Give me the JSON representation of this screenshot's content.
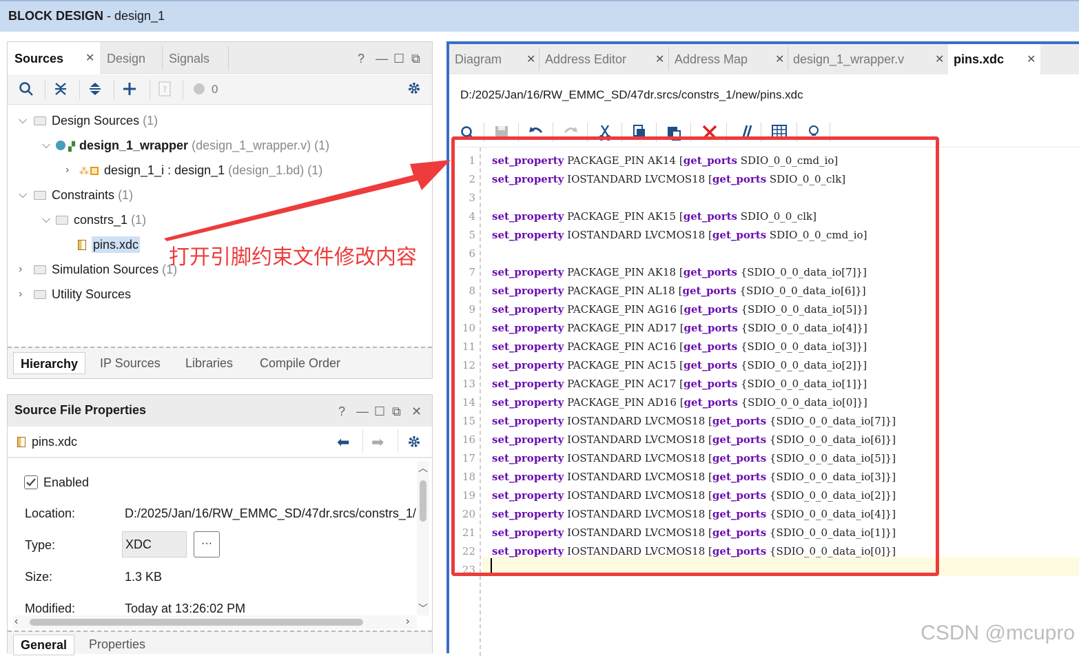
{
  "window": {
    "title_bold": "BLOCK DESIGN",
    "title_rest": " - design_1"
  },
  "sources_panel": {
    "tabs": [
      "Sources",
      "Design",
      "Signals"
    ],
    "help": "?",
    "count": "0",
    "tree": {
      "design_sources": {
        "label": "Design Sources",
        "count": "(1)"
      },
      "wrapper": {
        "label": "design_1_wrapper",
        "detail": "(design_1_wrapper.v) (1)"
      },
      "design_1_i": {
        "label": "design_1_i : design_1",
        "detail": "(design_1.bd) (1)"
      },
      "constraints": {
        "label": "Constraints",
        "count": "(1)"
      },
      "constrs_1": {
        "label": "constrs_1",
        "count": "(1)"
      },
      "pins": {
        "label": "pins.xdc"
      },
      "simulation": {
        "label": "Simulation Sources",
        "count": "(1)"
      },
      "utility": {
        "label": "Utility Sources"
      }
    },
    "bottom_tabs": [
      "Hierarchy",
      "IP Sources",
      "Libraries",
      "Compile Order"
    ]
  },
  "properties_panel": {
    "title": "Source File Properties",
    "help": "?",
    "file": "pins.xdc",
    "enabled_label": "Enabled",
    "enabled": true,
    "location_label": "Location:",
    "location": "D:/2025/Jan/16/RW_EMMC_SD/47dr.srcs/constrs_1/",
    "type_label": "Type:",
    "type": "XDC",
    "browse": "···",
    "size_label": "Size:",
    "size": "1.3 KB",
    "modified_label": "Modified:",
    "modified": "Today at 13:26:02 PM",
    "bottom_tabs": [
      "General",
      "Properties"
    ]
  },
  "editor": {
    "tabs": [
      "Diagram",
      "Address Editor",
      "Address Map",
      "design_1_wrapper.v",
      "pins.xdc"
    ],
    "path": "D:/2025/Jan/16/RW_EMMC_SD/47dr.srcs/constrs_1/new/pins.xdc",
    "lines": [
      {
        "n": "1",
        "a": "set_property",
        "b": " PACKAGE_PIN AK14 [",
        "c": "get_ports",
        "d": " SDIO_0_0_cmd_io]"
      },
      {
        "n": "2",
        "a": "set_property",
        "b": " IOSTANDARD LVCMOS18 [",
        "c": "get_ports",
        "d": " SDIO_0_0_clk]"
      },
      {
        "n": "3",
        "a": "",
        "b": "",
        "c": "",
        "d": ""
      },
      {
        "n": "4",
        "a": "set_property",
        "b": " PACKAGE_PIN AK15 [",
        "c": "get_ports",
        "d": " SDIO_0_0_clk]"
      },
      {
        "n": "5",
        "a": "set_property",
        "b": " IOSTANDARD LVCMOS18 [",
        "c": "get_ports",
        "d": " SDIO_0_0_cmd_io]"
      },
      {
        "n": "6",
        "a": "",
        "b": "",
        "c": "",
        "d": ""
      },
      {
        "n": "7",
        "a": "set_property",
        "b": " PACKAGE_PIN AK18 [",
        "c": "get_ports",
        "d": " {SDIO_0_0_data_io[7]}]"
      },
      {
        "n": "8",
        "a": "set_property",
        "b": " PACKAGE_PIN AL18 [",
        "c": "get_ports",
        "d": " {SDIO_0_0_data_io[6]}]"
      },
      {
        "n": "9",
        "a": "set_property",
        "b": " PACKAGE_PIN AG16 [",
        "c": "get_ports",
        "d": " {SDIO_0_0_data_io[5]}]"
      },
      {
        "n": "10",
        "a": "set_property",
        "b": " PACKAGE_PIN AD17 [",
        "c": "get_ports",
        "d": " {SDIO_0_0_data_io[4]}]"
      },
      {
        "n": "11",
        "a": "set_property",
        "b": " PACKAGE_PIN AC16 [",
        "c": "get_ports",
        "d": " {SDIO_0_0_data_io[3]}]"
      },
      {
        "n": "12",
        "a": "set_property",
        "b": " PACKAGE_PIN AC15 [",
        "c": "get_ports",
        "d": " {SDIO_0_0_data_io[2]}]"
      },
      {
        "n": "13",
        "a": "set_property",
        "b": " PACKAGE_PIN AC17 [",
        "c": "get_ports",
        "d": " {SDIO_0_0_data_io[1]}]"
      },
      {
        "n": "14",
        "a": "set_property",
        "b": " PACKAGE_PIN AD16 [",
        "c": "get_ports",
        "d": " {SDIO_0_0_data_io[0]}]"
      },
      {
        "n": "15",
        "a": "set_property",
        "b": " IOSTANDARD LVCMOS18 [",
        "c": "get_ports",
        "d": " {SDIO_0_0_data_io[7]}]"
      },
      {
        "n": "16",
        "a": "set_property",
        "b": " IOSTANDARD LVCMOS18 [",
        "c": "get_ports",
        "d": " {SDIO_0_0_data_io[6]}]"
      },
      {
        "n": "17",
        "a": "set_property",
        "b": " IOSTANDARD LVCMOS18 [",
        "c": "get_ports",
        "d": " {SDIO_0_0_data_io[5]}]"
      },
      {
        "n": "18",
        "a": "set_property",
        "b": " IOSTANDARD LVCMOS18 [",
        "c": "get_ports",
        "d": " {SDIO_0_0_data_io[3]}]"
      },
      {
        "n": "19",
        "a": "set_property",
        "b": " IOSTANDARD LVCMOS18 [",
        "c": "get_ports",
        "d": " {SDIO_0_0_data_io[2]}]"
      },
      {
        "n": "20",
        "a": "set_property",
        "b": " IOSTANDARD LVCMOS18 [",
        "c": "get_ports",
        "d": " {SDIO_0_0_data_io[4]}]"
      },
      {
        "n": "21",
        "a": "set_property",
        "b": " IOSTANDARD LVCMOS18 [",
        "c": "get_ports",
        "d": " {SDIO_0_0_data_io[1]}]"
      },
      {
        "n": "22",
        "a": "set_property",
        "b": " IOSTANDARD LVCMOS18 [",
        "c": "get_ports",
        "d": " {SDIO_0_0_data_io[0]}]"
      },
      {
        "n": "23",
        "a": "",
        "b": "",
        "c": "",
        "d": ""
      }
    ]
  },
  "annotation": {
    "text": "打开引脚约束文件修改内容",
    "color": "#ee3b3b"
  },
  "watermark": "CSDN @mcupro",
  "colors": {
    "titlebar": "#c9dbf1",
    "accent": "#3a6fc4",
    "keyword": "#6a0fb0"
  }
}
